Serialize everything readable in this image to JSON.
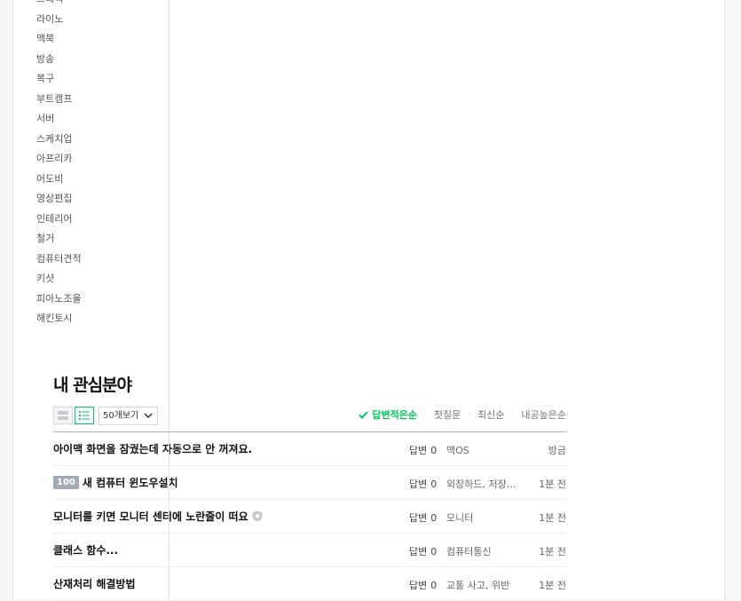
{
  "categories": [
    "그래픽",
    "라이노",
    "맥북",
    "방송",
    "복구",
    "부트캠프",
    "서버",
    "스케치업",
    "아프리카",
    "어도비",
    "영상편집",
    "인테리어",
    "철거",
    "컴퓨터견적",
    "키샷",
    "피아노조율",
    "해킨토시"
  ],
  "section": {
    "title": "내 관심분야"
  },
  "toolbar": {
    "page_size_label": "50개보기",
    "sort_tabs": [
      {
        "label": "답변적은순",
        "active": true
      },
      {
        "label": "첫질문",
        "active": false
      },
      {
        "label": "최신순",
        "active": false
      },
      {
        "label": "내공높은순",
        "active": false
      }
    ]
  },
  "questions": [
    {
      "title": "아이맥 화면을 잠궜는데 자동으로 안 꺼져요.",
      "badge": "",
      "answers_label": "답변",
      "answers": "0",
      "category": "맥OS",
      "time": "방금"
    },
    {
      "title": "새 컴퓨터 윈도우설치",
      "badge": "100",
      "answers_label": "답변",
      "answers": "0",
      "category": "외장하드, 저장장치",
      "time": "1분 전"
    },
    {
      "title": "모니터를 키면 모니터 센터에 노란줄이 떠요",
      "badge": "",
      "answers_label": "답변",
      "answers": "0",
      "category": "모니터",
      "time": "1분 전",
      "shield": true
    },
    {
      "title": "클래스 함수...",
      "badge": "",
      "answers_label": "답변",
      "answers": "0",
      "category": "컴퓨터통신",
      "time": "1분 전"
    },
    {
      "title": "산재처리 해결방법",
      "badge": "",
      "answers_label": "답변",
      "answers": "0",
      "category": "교통 사고, 위반",
      "time": "1분 전"
    }
  ],
  "colors": {
    "accent": "#03c75a",
    "badge": "#a4aab3"
  }
}
